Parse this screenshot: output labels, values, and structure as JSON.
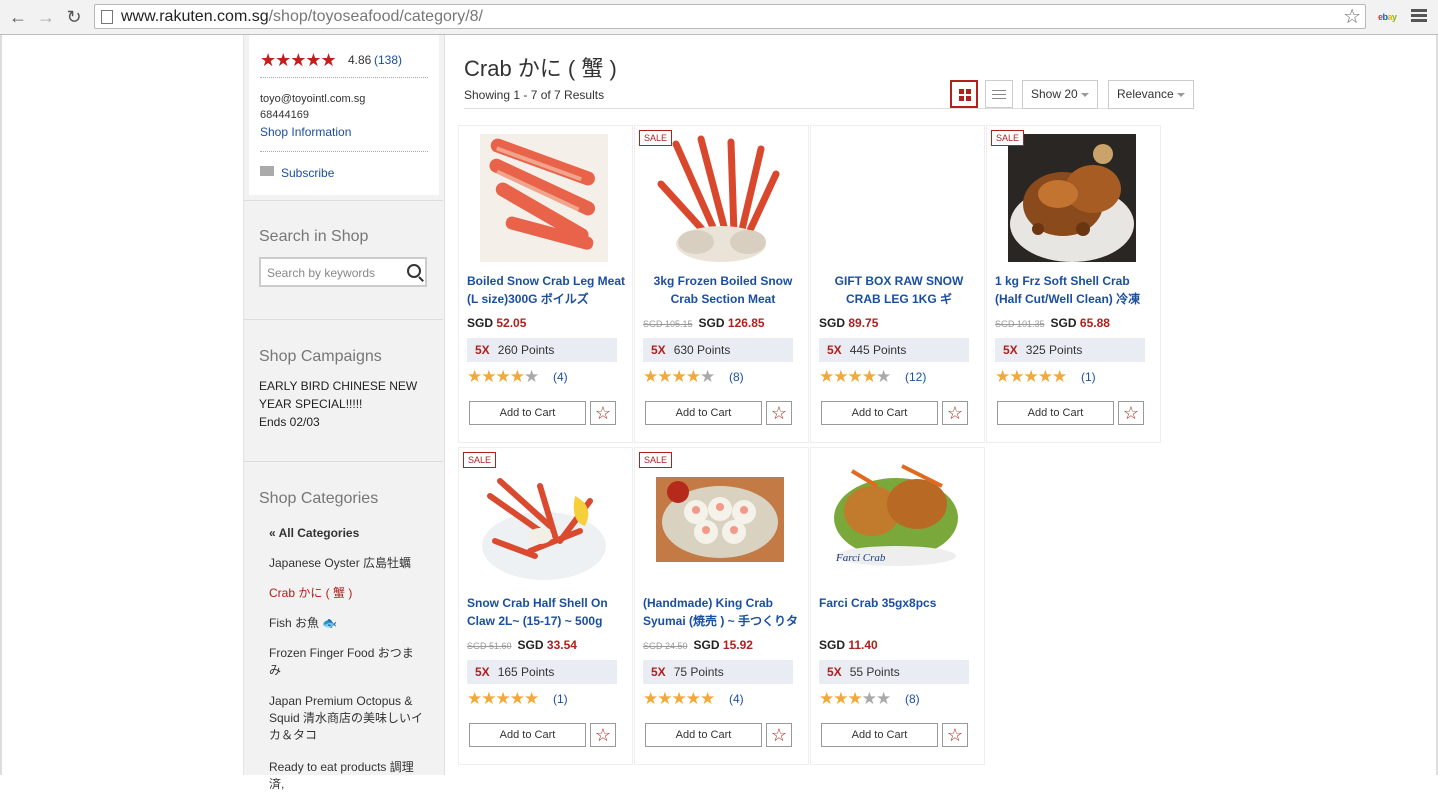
{
  "browser": {
    "url_domain": "www.rakuten.com.sg",
    "url_path": "/shop/toyoseafood/category/8/",
    "ext_label": "ebay"
  },
  "shop": {
    "rating": "4.86",
    "rating_count": "(138)",
    "email": "toyo@toyointl.com.sg",
    "phone": "68444169",
    "shop_info_link": "Shop Information",
    "subscribe_link": "Subscribe"
  },
  "search": {
    "title": "Search in Shop",
    "placeholder": "Search by keywords"
  },
  "campaigns": {
    "title": "Shop Campaigns",
    "line1": "EARLY BIRD CHINESE NEW",
    "line2": "YEAR SPECIAL!!!!!",
    "ends": "Ends 02/03"
  },
  "categories": {
    "title": "Shop Categories",
    "items": [
      "« All Categories",
      "Japanese Oyster 広島牡蠣",
      "Crab かに ( 蟹 )",
      "Fish お魚 🐟",
      "Frozen Finger Food おつまみ",
      "Japan Premium Octopus & Squid 清水商店の美味しいイカ＆タコ",
      "Ready to eat products 調理済,"
    ]
  },
  "main": {
    "title": "Crab かに ( 蟹 )",
    "results": "Showing 1 - 7 of 7 Results",
    "show_label": "Show 20",
    "sort_label": "Relevance"
  },
  "products": [
    {
      "name": "Boiled Snow Crab Leg Meat (L size)300G ボイルズ",
      "sale": "",
      "old_price": "",
      "currency": "SGD",
      "price": "52.05",
      "points_mult": "5X",
      "points": "260 Points",
      "rating": 4,
      "reviews": "(4)",
      "cart": "Add to Cart",
      "fav": "☆"
    },
    {
      "name": "3kg Frozen Boiled Snow Crab Section Meat",
      "sale": "SALE",
      "old_price": "SGD 105.15",
      "currency": "SGD",
      "price": "126.85",
      "points_mult": "5X",
      "points": "630 Points",
      "rating": 4,
      "reviews": "(8)",
      "cart": "Add to Cart",
      "fav": "☆"
    },
    {
      "name": "GIFT BOX RAW SNOW CRAB LEG 1KG ギ",
      "sale": "",
      "old_price": "",
      "currency": "SGD",
      "price": "89.75",
      "points_mult": "5X",
      "points": "445 Points",
      "rating": 4,
      "reviews": "(12)",
      "cart": "Add to Cart",
      "fav": "☆"
    },
    {
      "name": "1 kg Frz Soft Shell Crab (Half Cut/Well Clean) 冷凍",
      "sale": "SALE",
      "old_price": "SGD 101.35",
      "currency": "SGD",
      "price": "65.88",
      "points_mult": "5X",
      "points": "325 Points",
      "rating": 5,
      "reviews": "(1)",
      "cart": "Add to Cart",
      "fav": "☆"
    },
    {
      "name": "Snow Crab Half Shell On Claw 2L~ (15-17) ~ 500g",
      "sale": "SALE",
      "old_price": "SGD 51.60",
      "currency": "SGD",
      "price": "33.54",
      "points_mult": "5X",
      "points": "165 Points",
      "rating": 5,
      "reviews": "(1)",
      "cart": "Add to Cart",
      "fav": "☆"
    },
    {
      "name": "(Handmade) King Crab Syumai (焼売 ) ~ 手つくりタ",
      "sale": "SALE",
      "old_price": "SGD 24.50",
      "currency": "SGD",
      "price": "15.92",
      "points_mult": "5X",
      "points": "75 Points",
      "rating": 5,
      "reviews": "(4)",
      "cart": "Add to Cart",
      "fav": "☆"
    },
    {
      "name": "Farci Crab 35gx8pcs",
      "sale": "",
      "old_price": "",
      "currency": "SGD",
      "price": "11.40",
      "points_mult": "5X",
      "points": "55 Points",
      "rating": 3,
      "reviews": "(8)",
      "cart": "Add to Cart",
      "fav": "☆",
      "image_label": "Farci Crab"
    }
  ],
  "colors": {
    "brand_red": "#b0201c",
    "link_blue": "#1a4fa0",
    "star_gold": "#f2a93b",
    "points_bg": "#e9edf3"
  }
}
